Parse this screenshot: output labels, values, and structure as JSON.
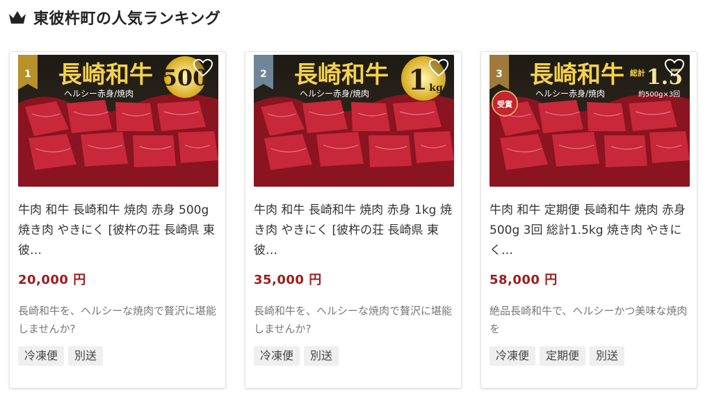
{
  "header": {
    "title": "東彼杵町の人気ランキング"
  },
  "colors": {
    "price": "#9b1c1c",
    "rank1": "#b8912a",
    "rank2": "#6f8598",
    "rank3": "#a07a3a",
    "heart": "#ffffff"
  },
  "items": [
    {
      "rank": "1",
      "image_text": {
        "brand": "長崎和牛",
        "sub": "ヘルシー赤身焼肉",
        "amount": "500g"
      },
      "name": "牛肉 和牛 長崎和牛 焼肉 赤身 500g 焼き肉 やきにく [彼杵の荘 長崎県 東彼…",
      "price": "20,000 円",
      "description": "長崎和牛を、ヘルシーな焼肉で贅沢に堪能しませんか?",
      "tags": [
        "冷凍便",
        "別送"
      ]
    },
    {
      "rank": "2",
      "image_text": {
        "brand": "長崎和牛",
        "sub": "ヘルシー赤身焼肉",
        "amount": "1kg"
      },
      "name": "牛肉 和牛 長崎和牛 焼肉 赤身 1kg 焼き肉 やきにく [彼杵の荘 長崎県 東彼…",
      "price": "35,000 円",
      "description": "長崎和牛を、ヘルシーな焼肉で贅沢に堪能しませんか?",
      "tags": [
        "冷凍便",
        "別送"
      ]
    },
    {
      "rank": "3",
      "image_text": {
        "brand": "長崎和牛",
        "sub": "ヘルシー赤身焼肉",
        "amount": "1.5kg",
        "prefix": "総計",
        "note": "約500g×3回",
        "award": "受賞"
      },
      "name": "牛肉 和牛 定期便 長崎和牛 焼肉 赤身 500g 3回 総計1.5kg 焼き肉 やきにく…",
      "price": "58,000 円",
      "description": "絶品長崎和牛で、ヘルシーかつ美味な焼肉を",
      "tags": [
        "冷凍便",
        "定期便",
        "別送"
      ]
    }
  ]
}
